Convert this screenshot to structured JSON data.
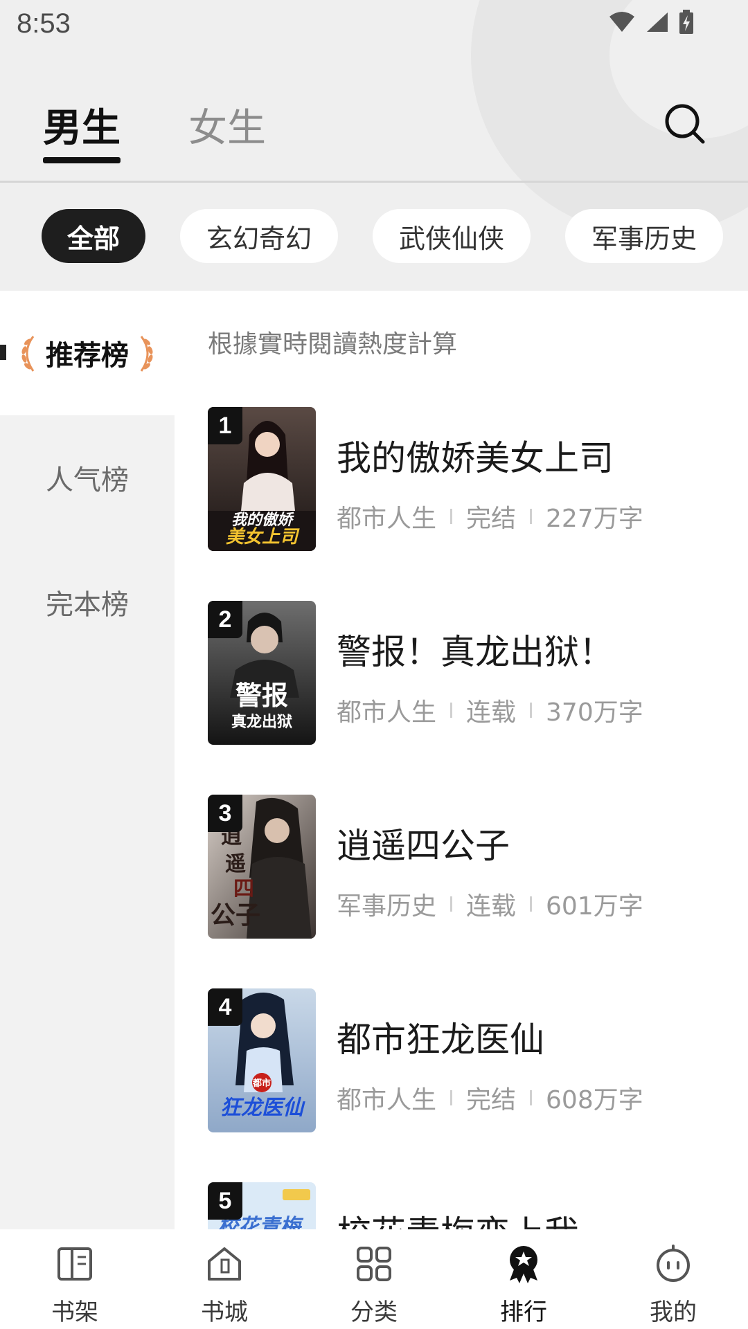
{
  "status_bar": {
    "time": "8:53"
  },
  "header": {
    "tabs": [
      {
        "label": "男生",
        "active": true
      },
      {
        "label": "女生",
        "active": false
      }
    ]
  },
  "categories": [
    {
      "label": "全部",
      "active": true
    },
    {
      "label": "玄幻奇幻",
      "active": false
    },
    {
      "label": "武侠仙侠",
      "active": false
    },
    {
      "label": "军事历史",
      "active": false
    }
  ],
  "rank_tabs": [
    {
      "label": "推荐榜",
      "active": true
    },
    {
      "label": "人气榜",
      "active": false
    },
    {
      "label": "完本榜",
      "active": false
    }
  ],
  "list": {
    "note": "根據實時閱讀熱度計算",
    "books": [
      {
        "rank": "1",
        "title": "我的傲娇美女上司",
        "genre": "都市人生",
        "status": "完结",
        "words": "227万字",
        "cover_text": "我的傲娇美女上司"
      },
      {
        "rank": "2",
        "title": "警报！真龙出狱！",
        "genre": "都市人生",
        "status": "连载",
        "words": "370万字",
        "cover_text": "警报真龙出狱"
      },
      {
        "rank": "3",
        "title": "逍遥四公子",
        "genre": "军事历史",
        "status": "连载",
        "words": "601万字",
        "cover_text": "逍遥四公子"
      },
      {
        "rank": "4",
        "title": "都市狂龙医仙",
        "genre": "都市人生",
        "status": "完结",
        "words": "608万字",
        "cover_text": "都市狂龙医仙"
      },
      {
        "rank": "5",
        "title": "校花青梅恋上我",
        "genre": "",
        "status": "",
        "words": "",
        "cover_text": "校花青梅"
      }
    ]
  },
  "bottom_nav": [
    {
      "label": "书架",
      "icon": "bookshelf-icon",
      "active": false
    },
    {
      "label": "书城",
      "icon": "bookstore-icon",
      "active": false
    },
    {
      "label": "分类",
      "icon": "category-icon",
      "active": false
    },
    {
      "label": "排行",
      "icon": "ranking-icon",
      "active": true
    },
    {
      "label": "我的",
      "icon": "profile-icon",
      "active": false
    }
  ],
  "colors": {
    "accent": "#1e1e1e",
    "laurel": "#e8935a",
    "background": "#efefef"
  }
}
